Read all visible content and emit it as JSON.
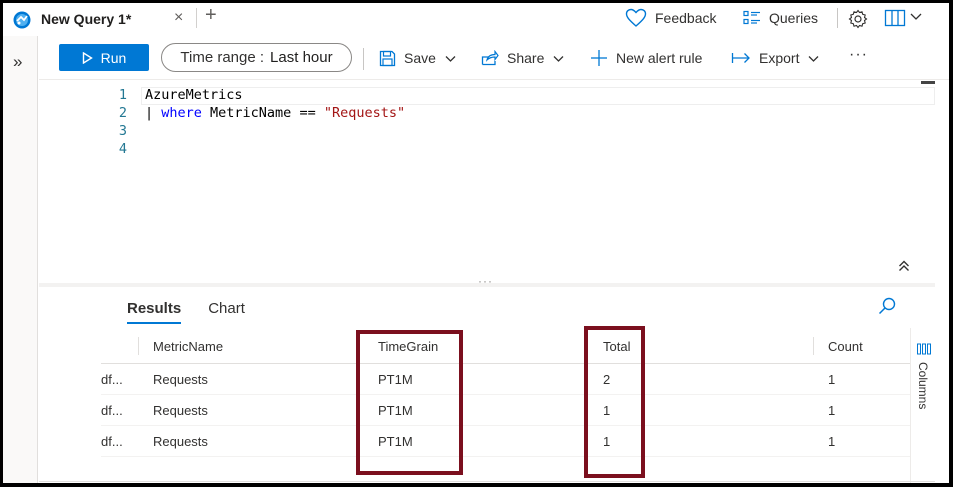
{
  "tab": {
    "title": "New Query 1*",
    "close": "×",
    "add": "+"
  },
  "topbar": {
    "feedback": "Feedback",
    "queries": "Queries"
  },
  "leftrail": {
    "expand": "»"
  },
  "toolbar": {
    "run": "Run",
    "time_range_label": "Time range :",
    "time_range_value": "Last hour",
    "save": "Save",
    "share": "Share",
    "new_alert_rule": "New alert rule",
    "export": "Export",
    "more": "···"
  },
  "editor": {
    "line_numbers": [
      "1",
      "2",
      "3",
      "4"
    ],
    "line1": "AzureMetrics",
    "line2_pipe": "| ",
    "line2_kw": "where",
    "line2_mid": " MetricName == ",
    "line2_str": "\"Requests\""
  },
  "results": {
    "tabs": [
      "Results",
      "Chart"
    ],
    "columns": [
      "MetricName",
      "TimeGrain",
      "Total",
      "Count"
    ],
    "rows": [
      {
        "prefix": "df...",
        "MetricName": "Requests",
        "TimeGrain": "PT1M",
        "Total": "2",
        "Count": "1"
      },
      {
        "prefix": "df...",
        "MetricName": "Requests",
        "TimeGrain": "PT1M",
        "Total": "1",
        "Count": "1"
      },
      {
        "prefix": "df...",
        "MetricName": "Requests",
        "TimeGrain": "PT1M",
        "Total": "1",
        "Count": "1"
      }
    ],
    "columns_panel": "Columns"
  },
  "colors": {
    "accent": "#0078d4",
    "highlight_box": "#7b0f1e",
    "string": "#a31515",
    "keyword": "#0000ff",
    "line_number": "#237893"
  }
}
